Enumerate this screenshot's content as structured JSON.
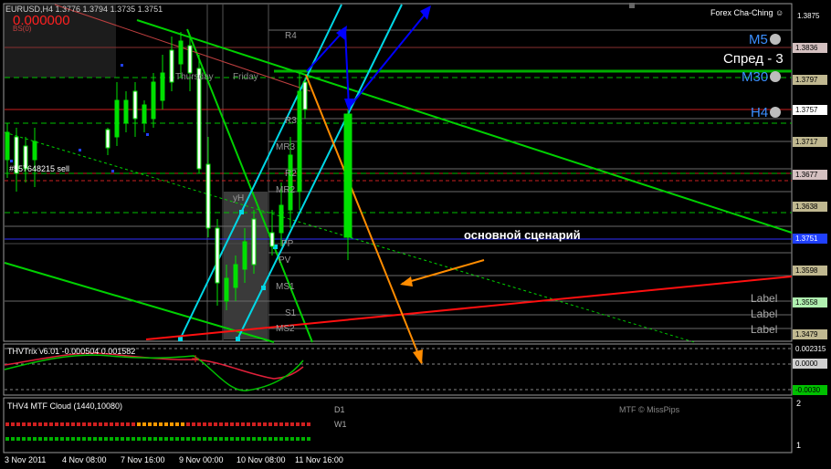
{
  "main_chart": {
    "symbol_line": "EURUSD,H4  1.3776 1.3794 1.3735 1.3751",
    "bid_value": "0.000000",
    "bs_label": "BS(0)",
    "order_label": "#557648215 sell",
    "brand": "Forex Cha-Ching ☺",
    "spread_label": "Спред - 3",
    "tf_labels": [
      "M5",
      "M30",
      "H4"
    ],
    "scenario_label": "основной сценарий",
    "pivot_labels": [
      "R4",
      "R3",
      "MR3",
      "R2",
      "MR2",
      "PP",
      "MS1",
      "S1",
      "MS2",
      "PV",
      "yH"
    ],
    "day_labels": [
      "Thursday",
      "Friday"
    ],
    "label_words": [
      "Label",
      "Label",
      "Label"
    ],
    "price_ticks": [
      "1.3875",
      "1.3836",
      "1.3797",
      "1.3757",
      "1.3717",
      "1.3677",
      "1.3638",
      "1.3598",
      "1.3558",
      "1.3518",
      "1.3479"
    ],
    "current_price": "1.3751",
    "colors": {
      "bull": "#00e000",
      "bear": "#ffffff",
      "channel": "#00d000",
      "cyan": "#00d7e6",
      "blue": "#0000ff",
      "orange": "#ff8c00",
      "red": "#ff0000"
    }
  },
  "trix_panel": {
    "title": "THVTrix v6.01 -0.000504 0.001582",
    "ticks": [
      "0.002315",
      "0.0000",
      "-0.0030"
    ]
  },
  "cloud_panel": {
    "title": "THV4 MTF Cloud (1440,10080)",
    "labels": [
      "D1",
      "W1"
    ],
    "credit": "MTF © MissPips",
    "ticks": [
      "2",
      "1"
    ]
  },
  "time_axis": [
    "3 Nov 2011",
    "4 Nov 08:00",
    "7 Nov 16:00",
    "9 Nov 00:00",
    "10 Nov 08:00",
    "11 Nov 16:00"
  ]
}
